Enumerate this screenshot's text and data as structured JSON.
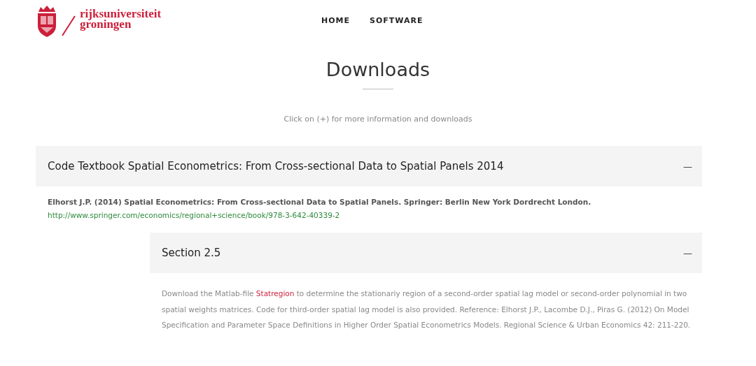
{
  "header": {
    "logo_text": [
      "rijksuniversiteit",
      "groningen"
    ],
    "nav": [
      {
        "label": "HOME",
        "selected": false
      },
      {
        "label": "SOFTWARE",
        "selected": false
      }
    ]
  },
  "page": {
    "title": "Downloads",
    "subtitle": "Click on (+) for more information and downloads"
  },
  "accordion": [
    {
      "title": "Code Textbook Spatial Econometrics: From Cross-sectional Data to Spatial Panels 2014",
      "toggle": "—",
      "expanded": true,
      "reference": "Elhorst J.P. (2014) Spatial Econometrics: From Cross-sectional Data to Spatial Panels. Springer: Berlin New York Dordrecht London.",
      "link": "http://www.springer.com/economics/regional+science/book/978-3-642-40339-2",
      "sections": [
        {
          "title": "Section 2.5",
          "toggle": "—",
          "expanded": true,
          "text_before": "Download the Matlab-file ",
          "link": "Statregion",
          "text_after": " to determine the stationariy region of a second-order spatial lag model or second-order polynomial in two spatial weights matrices. Code for third-order spatial lag model is also provided. Reference: Elhorst J.P., Lacombe D.J., Piras G. (2012) On Model Specification and Parameter Space Definitions in Higher Order Spatial Econometrics Models. Regional Science & Urban Economics 42: 211-220."
        }
      ]
    }
  ]
}
